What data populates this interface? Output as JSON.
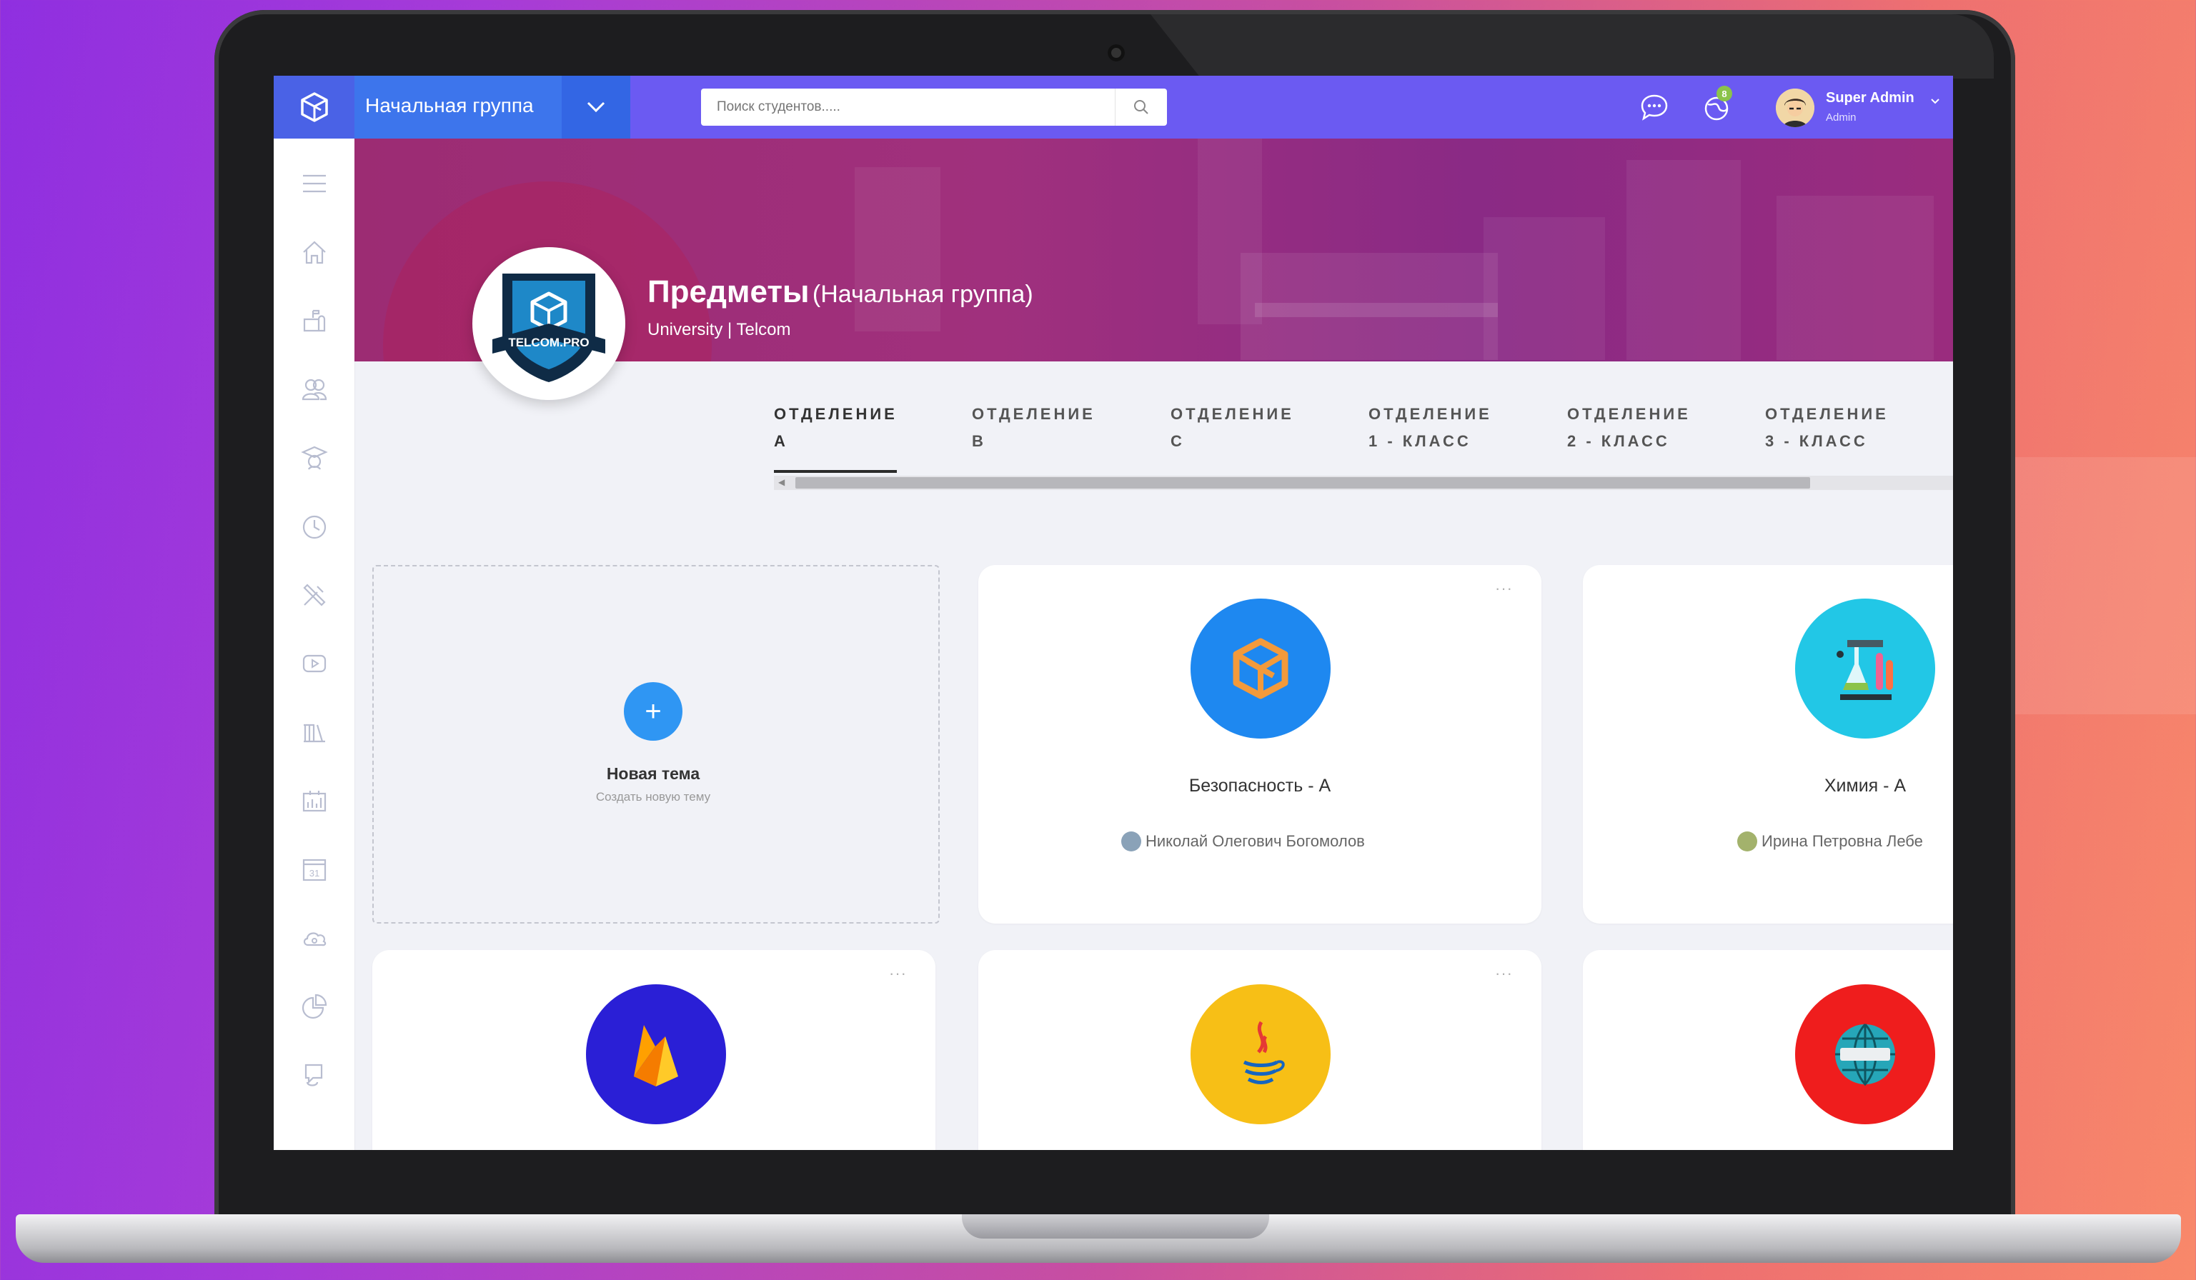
{
  "header": {
    "group_name": "Начальная группа",
    "search_placeholder": "Поиск студентов.....",
    "notification_count": "8",
    "user_name": "Super Admin",
    "user_role": "Admin"
  },
  "sidebar": {
    "icons": [
      "menu-icon",
      "home-icon",
      "mail-icon",
      "users-icon",
      "graduation-cap-icon",
      "clock-icon",
      "tools-icon",
      "video-icon",
      "library-icon",
      "chart-icon",
      "calendar-icon",
      "cloud-icon",
      "pie-chart-icon",
      "support-icon"
    ],
    "calendar_day": "31"
  },
  "page": {
    "title": "Предметы",
    "title_suffix": "(Начальная группа)",
    "subtitle": "University | Telcom",
    "logo_text": "TELCOM.PRO"
  },
  "tabs": [
    {
      "line1": "ОТДЕЛЕНИЕ",
      "line2": "А"
    },
    {
      "line1": "ОТДЕЛЕНИЕ",
      "line2": "В"
    },
    {
      "line1": "ОТДЕЛЕНИЕ",
      "line2": "С"
    },
    {
      "line1": "ОТДЕЛЕНИЕ",
      "line2": "1 - КЛАСС"
    },
    {
      "line1": "ОТДЕЛЕНИЕ",
      "line2": "2 - КЛАСС"
    },
    {
      "line1": "ОТДЕЛЕНИЕ",
      "line2": "3 - КЛАСС"
    }
  ],
  "new_topic": {
    "plus": "+",
    "title": "Новая тема",
    "subtitle": "Создать новую тему"
  },
  "cards": [
    {
      "title": "Безопасность - А",
      "teacher": "Николай Олегович Богомолов",
      "menu": "···"
    },
    {
      "title": "Химия - А",
      "teacher": "Ирина Петровна Лебе",
      "menu": "···"
    },
    {
      "title": "",
      "teacher": "",
      "menu": "···"
    },
    {
      "title": "",
      "teacher": "",
      "menu": "···"
    },
    {
      "title": "",
      "teacher": "",
      "menu": "···"
    }
  ],
  "colors": {
    "topbar": "#6b5af2",
    "accent_blue": "#2f96f3",
    "banner": "#9c2c73",
    "security_icon_bg": "#1e88f0",
    "chemistry_icon_bg": "#22c7e6",
    "firebase_icon_bg": "#2a1fd6",
    "java_icon_bg": "#f7bf16",
    "web_icon_bg": "#ef1d1d"
  }
}
